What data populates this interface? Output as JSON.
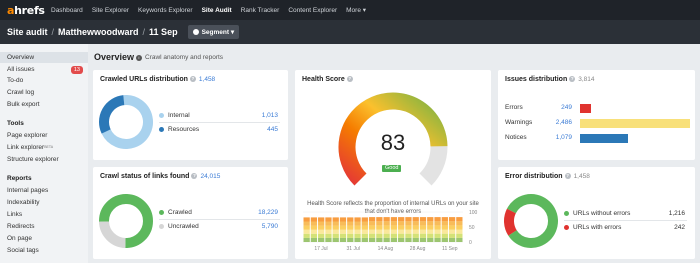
{
  "brand": {
    "prefix": "a",
    "rest": "hrefs"
  },
  "nav": [
    {
      "label": "Dashboard",
      "active": false
    },
    {
      "label": "Site Explorer",
      "active": false
    },
    {
      "label": "Keywords Explorer",
      "active": false
    },
    {
      "label": "Site Audit",
      "active": true
    },
    {
      "label": "Rank Tracker",
      "active": false
    },
    {
      "label": "Content Explorer",
      "active": false
    },
    {
      "label": "More ▾",
      "active": false
    }
  ],
  "breadcrumb": {
    "section": "Site audit",
    "project": "Matthewwoodward",
    "date": "11 Sep",
    "segment": "Segment ▾"
  },
  "sidebar": {
    "items_top": [
      {
        "label": "Overview",
        "active": true
      },
      {
        "label": "All issues",
        "badge": "13"
      },
      {
        "label": "To-do"
      },
      {
        "label": "Crawl log"
      },
      {
        "label": "Bulk export"
      }
    ],
    "tools_heading": "Tools",
    "tools": [
      {
        "label": "Page explorer"
      },
      {
        "label": "Link explorer",
        "sup": "BETA"
      },
      {
        "label": "Structure explorer"
      }
    ],
    "reports_heading": "Reports",
    "reports": [
      {
        "label": "Internal pages"
      },
      {
        "label": "Indexability"
      },
      {
        "label": "Links"
      },
      {
        "label": "Redirects"
      },
      {
        "label": "On page"
      },
      {
        "label": "Social tags"
      }
    ]
  },
  "page": {
    "title": "Overview",
    "subtitle": "Crawl anatomy and reports"
  },
  "crawled_urls": {
    "title": "Crawled URLs distribution",
    "count": "1,458",
    "rows": [
      {
        "label": "Internal",
        "value": "1,013",
        "color": "#a9d2ee"
      },
      {
        "label": "Resources",
        "value": "445",
        "color": "#2b78b7"
      }
    ]
  },
  "crawl_status": {
    "title": "Crawl status of links found",
    "count": "24,015",
    "rows": [
      {
        "label": "Crawled",
        "value": "18,229",
        "color": "#5cb85c"
      },
      {
        "label": "Uncrawled",
        "value": "5,790",
        "color": "#d6d6d6"
      }
    ]
  },
  "health": {
    "title": "Health Score",
    "score": "83",
    "status": "Good",
    "description": "Health Score reflects the proportion of internal URLs on your site that don't have errors",
    "history_labels": [
      "17 Jul",
      "31 Jul",
      "14 Aug",
      "28 Aug",
      "11 Sep"
    ],
    "y_ticks": [
      "100",
      "50",
      "0"
    ]
  },
  "issues": {
    "title": "Issues distribution",
    "count": "3,814",
    "rows": [
      {
        "label": "Errors",
        "value": "249",
        "color": "#e0332f"
      },
      {
        "label": "Warnings",
        "value": "2,486",
        "color": "#f8e07a"
      },
      {
        "label": "Notices",
        "value": "1,079",
        "color": "#2b78b7"
      }
    ]
  },
  "errors": {
    "title": "Error distribution",
    "count": "1,458",
    "rows": [
      {
        "label": "URLs without errors",
        "value": "1,216",
        "color": "#5cb85c"
      },
      {
        "label": "URLs with errors",
        "value": "242",
        "color": "#e0332f"
      }
    ]
  },
  "chart_data": [
    {
      "type": "pie",
      "title": "Crawled URLs distribution",
      "categories": [
        "Internal",
        "Resources"
      ],
      "values": [
        1013,
        445
      ]
    },
    {
      "type": "pie",
      "title": "Crawl status of links found",
      "categories": [
        "Crawled",
        "Uncrawled"
      ],
      "values": [
        18229,
        5790
      ]
    },
    {
      "type": "bar",
      "title": "Issues distribution",
      "categories": [
        "Errors",
        "Warnings",
        "Notices"
      ],
      "values": [
        249,
        2486,
        1079
      ]
    },
    {
      "type": "pie",
      "title": "Error distribution",
      "categories": [
        "URLs without errors",
        "URLs with errors"
      ],
      "values": [
        1216,
        242
      ]
    },
    {
      "type": "bar",
      "title": "",
      "categories": [
        "17 Jul",
        "31 Jul",
        "14 Aug",
        "28 Aug",
        "11 Sep"
      ],
      "values": [
        82,
        82,
        83,
        83,
        83
      ],
      "ylim": [
        0,
        100
      ]
    }
  ]
}
